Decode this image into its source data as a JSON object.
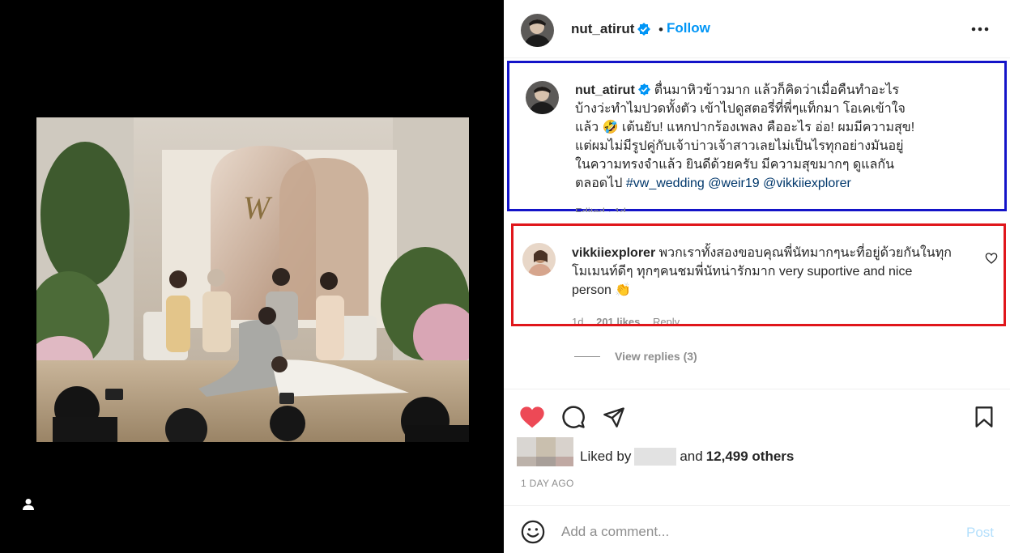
{
  "post": {
    "username": "nut_atirut",
    "dot": "•",
    "follow_label": "Follow",
    "more_icon": "more-horizontal-icon",
    "photo_monogram": "W"
  },
  "caption": {
    "username": "nut_atirut",
    "text": "ตื่นมาหิวข้าวมาก แล้วก็คิดว่าเมื่อคืนทำอะไรบ้างว่ะทำไมปวดทั้งตัว เข้าไปดูสตอรี่ที่พี่ๆแท็กมา โอเคเข้าใจแล้ว 🤣 เต้นยับ! แหกปากร้องเพลง คืออะไร อ่อ! ผมมีความสุข! แต่ผมไม่มีรูปคู่กับเจ้าบ่าวเจ้าสาวเลยไม่เป็นไรทุกอย่างมันอยู่ในความทรงจำแล้ว ยินดีด้วยครับ มีความสุขมากๆ ดูแลกันตลอดไป",
    "hashtag": "#vw_wedding",
    "mention1": "@weir19",
    "mention2": "@vikkiiexplorer",
    "meta": "Edited · 1d"
  },
  "comment": {
    "username": "vikkiiexplorer",
    "text": "พวกเราทั้งสองขอบคุณพี่นัทมากๆนะที่อยู่ด้วยกันในทุกโมเมนท์ดีๆ ทุกๆคนชมพี่นัทน่ารักมาก very suportive and nice person 👏",
    "time": "1d",
    "likes": "201 likes",
    "reply": "Reply"
  },
  "view_replies": "View replies (3)",
  "likes": {
    "prefix": "Liked by",
    "middle": "and",
    "count": "12,499 others"
  },
  "timestamp": "1 DAY AGO",
  "add_comment": {
    "placeholder": "Add a comment...",
    "post_label": "Post"
  },
  "colors": {
    "accent": "#0095f6",
    "like_red": "#ed4956",
    "caption_highlight": "#1414c8",
    "comment_highlight": "#e0161b"
  }
}
